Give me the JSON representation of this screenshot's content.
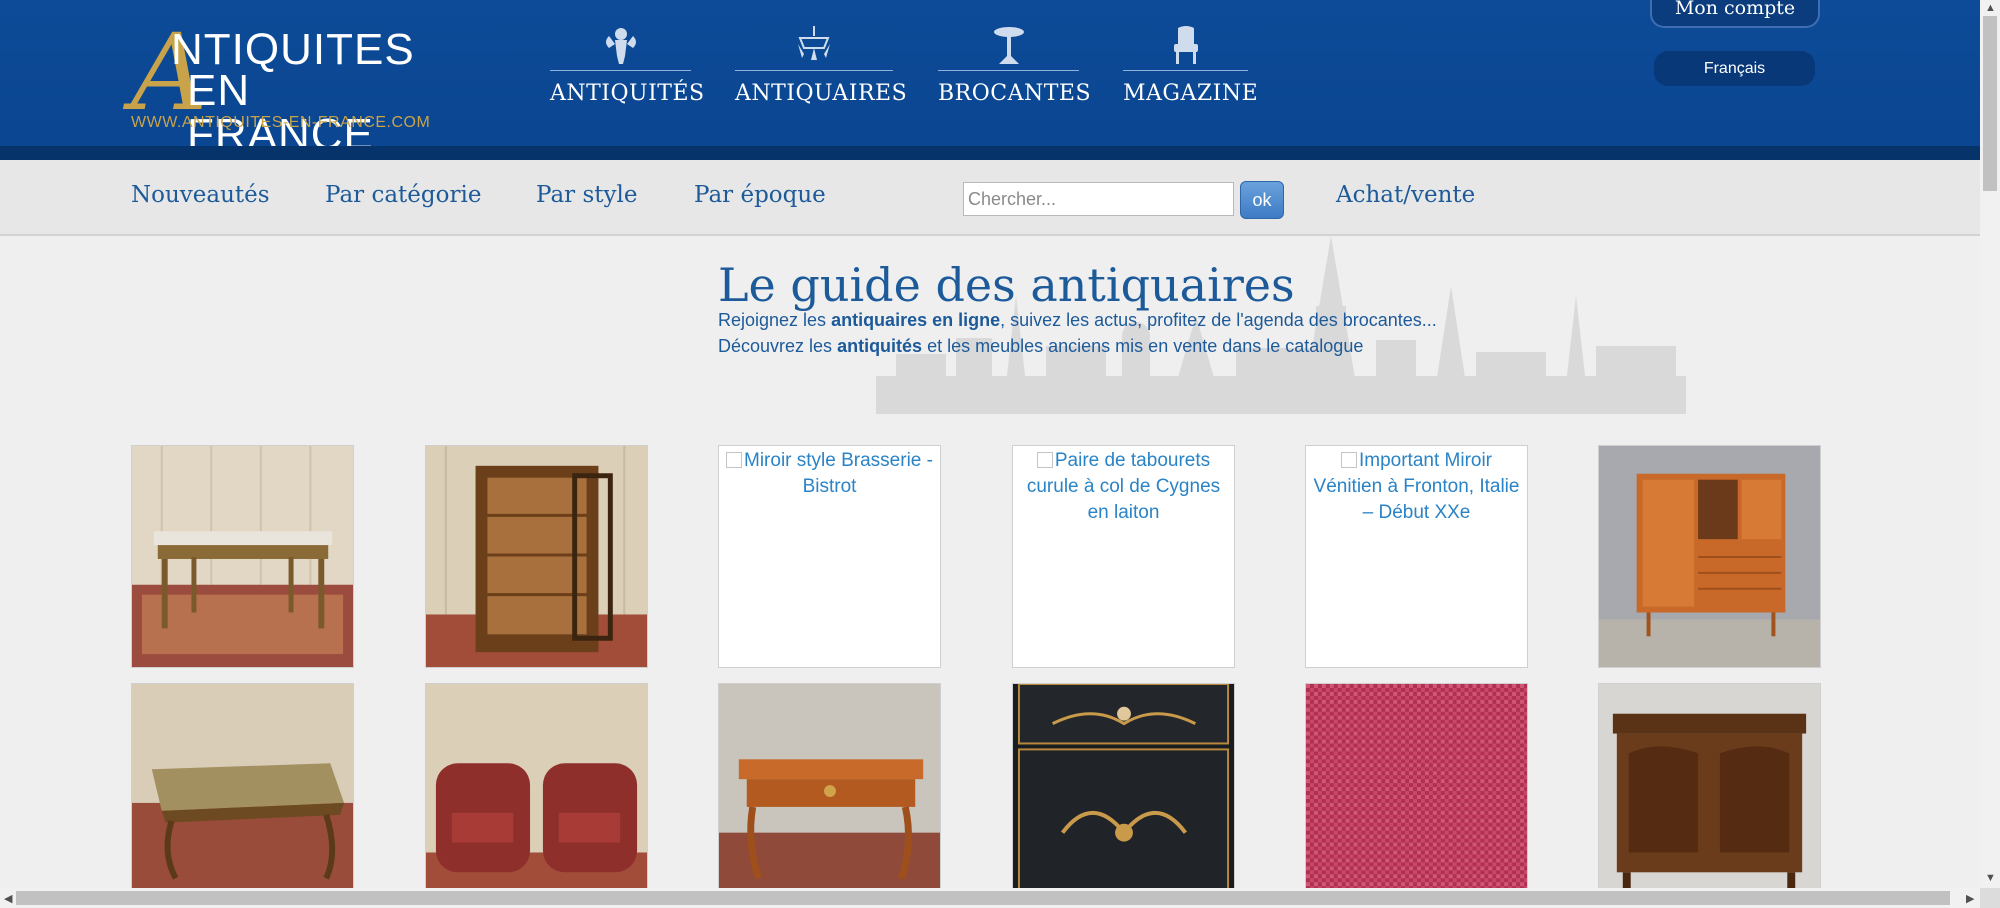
{
  "header": {
    "logo": {
      "letter": "A",
      "line1": "NTIQUITES",
      "line2": "EN FRANCE",
      "url": "WWW.ANTIQUITES-EN-FRANCE.COM"
    },
    "nav": [
      {
        "label": "ANTIQUITÉS",
        "icon": "cherub-icon"
      },
      {
        "label": "ANTIQUAIRES",
        "icon": "chandelier-icon"
      },
      {
        "label": "BROCANTES",
        "icon": "pedestal-table-icon"
      },
      {
        "label": "MAGAZINE",
        "icon": "armchair-icon"
      }
    ],
    "account_label": "Mon compte",
    "language": "Français"
  },
  "subnav": {
    "links": [
      "Nouveautés",
      "Par catégorie",
      "Par style",
      "Par époque"
    ],
    "search_placeholder": "Chercher...",
    "search_button": "ok",
    "extra_link": "Achat/vente"
  },
  "hero": {
    "title": "Le guide des antiquaires",
    "line1": {
      "pre": "Rejoignez les ",
      "bold": "antiquaires en ligne",
      "post": ", suivez les actus, profitez de l'agenda des brocantes..."
    },
    "line2": {
      "pre": "Découvrez les ",
      "bold": "antiquités",
      "post": " et les meubles anciens mis en vente dans le catalogue"
    }
  },
  "products": [
    {
      "type": "marble-console-table",
      "alt": ""
    },
    {
      "type": "glass-vitrine-cabinet",
      "alt": ""
    },
    {
      "type": "broken",
      "alt": "Miroir style Brasserie - Bistrot"
    },
    {
      "type": "broken",
      "alt": "Paire de tabourets curule à col de Cygnes en laiton"
    },
    {
      "type": "broken",
      "alt": "Important Miroir Vénitien à Fronton, Italie – Début XXe"
    },
    {
      "type": "teak-sideboard",
      "alt": ""
    },
    {
      "type": "onyx-coffee-table",
      "alt": ""
    },
    {
      "type": "red-armchairs-pair",
      "alt": ""
    },
    {
      "type": "louis-xv-desk",
      "alt": ""
    },
    {
      "type": "lacquered-cabinet",
      "alt": ""
    },
    {
      "type": "red-fabric",
      "alt": ""
    },
    {
      "type": "provencal-buffet",
      "alt": ""
    }
  ],
  "colors": {
    "header_blue": "#0d4b98",
    "gold": "#c8a34a",
    "link_blue": "#1d5a9a",
    "alt_text_blue": "#2a83c6"
  }
}
